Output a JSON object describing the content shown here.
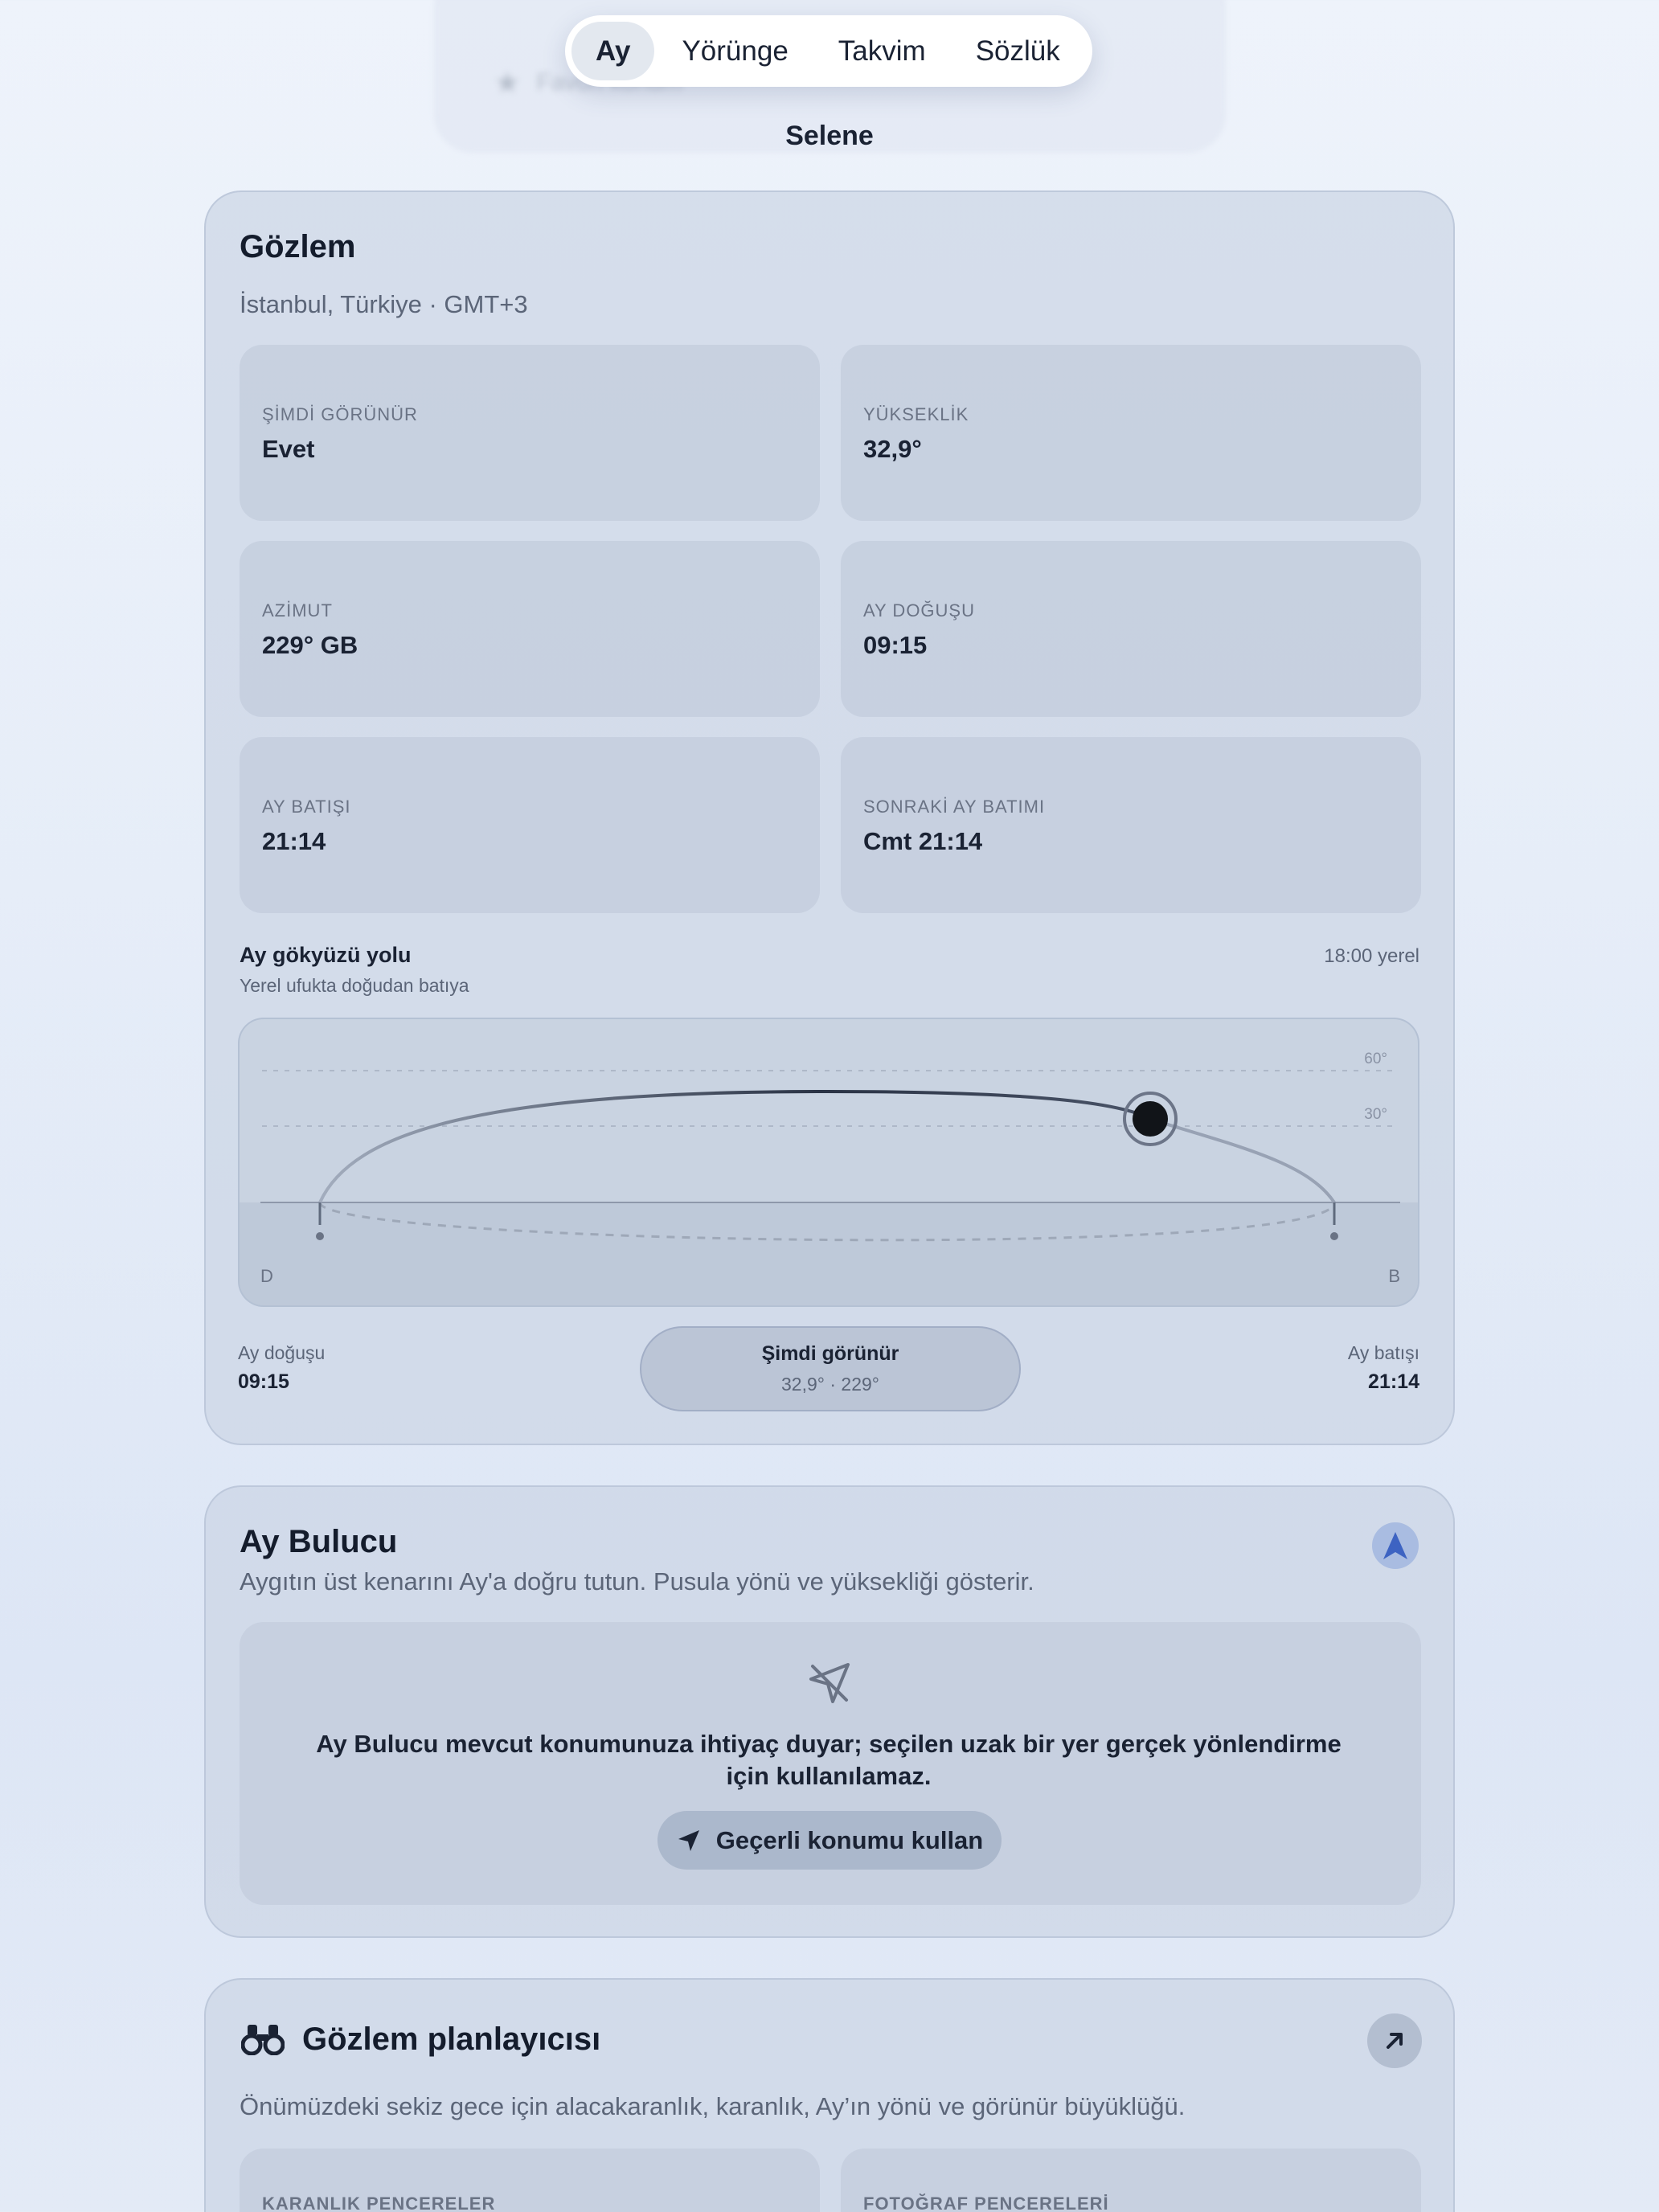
{
  "ghost": {
    "star_label": "Favori konum"
  },
  "tabs": [
    {
      "label": "Ay"
    },
    {
      "label": "Yörünge"
    },
    {
      "label": "Takvim"
    },
    {
      "label": "Sözlük"
    }
  ],
  "app_title": "Selene",
  "observation": {
    "title": "Gözlem",
    "location": "İstanbul, Türkiye · GMT+3",
    "stats": [
      {
        "label": "ŞİMDİ GÖRÜNÜR",
        "value": "Evet"
      },
      {
        "label": "YÜKSEKLİK",
        "value": "32,9°"
      },
      {
        "label": "AZİMUT",
        "value": "229° GB"
      },
      {
        "label": "AY DOĞUŞU",
        "value": "09:15"
      },
      {
        "label": "AY BATIŞI",
        "value": "21:14"
      },
      {
        "label": "SONRAKİ AY BATIMI",
        "value": "Cmt 21:14"
      }
    ],
    "sky_path": {
      "title": "Ay gökyüzü yolu",
      "subtitle": "Yerel ufukta doğudan batıya",
      "time_label": "18:00 yerel",
      "grid_60": "60°",
      "grid_30": "30°",
      "east_label": "D",
      "west_label": "B",
      "moon_altitude_deg": 32.9,
      "moon_azimuth_deg": 229
    },
    "rise": {
      "label": "Ay doğuşu",
      "time": "09:15"
    },
    "set": {
      "label": "Ay batışı",
      "time": "21:14"
    },
    "now_pill": {
      "title": "Şimdi görünür",
      "detail": "32,9° · 229°"
    }
  },
  "finder": {
    "title": "Ay Bulucu",
    "description": "Aygıtın üst kenarını Ay'a doğru tutun. Pusula yönü ve yüksekliği gösterir.",
    "notice": "Ay Bulucu mevcut konumunuza ihtiyaç duyar; seçilen uzak bir yer gerçek yönlendirme için kullanılamaz.",
    "button_label": "Geçerli konumu kullan"
  },
  "planner": {
    "title": "Gözlem planlayıcısı",
    "description": "Önümüzdeki sekiz gece için alacakaranlık, karanlık, Ay’ın yönü ve görünür büyüklüğü.",
    "sections": [
      {
        "label": "KARANLIK PENCERELER"
      },
      {
        "label": "FOTOĞRAF PENCERELERİ"
      }
    ]
  },
  "colors": {
    "accent_blue": "#3d63c2",
    "text_primary": "#1a2233",
    "card_bg": "#ccd5e4"
  }
}
